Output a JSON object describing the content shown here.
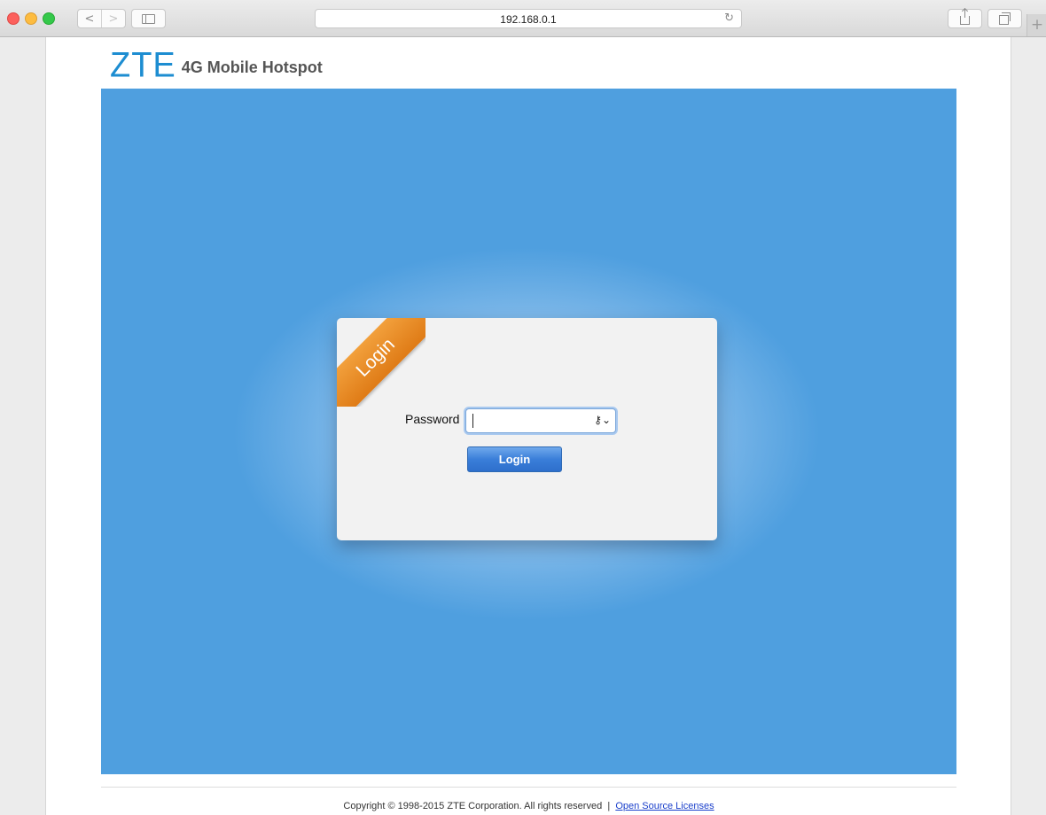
{
  "browser": {
    "url": "192.168.0.1",
    "back_symbol": "<",
    "forward_symbol": ">",
    "reload_symbol": "↻",
    "new_tab_symbol": "+"
  },
  "header": {
    "logo_brand": "ZTE",
    "logo_subtitle": "4G Mobile Hotspot"
  },
  "login": {
    "ribbon_label": "Login",
    "password_label": "Password",
    "password_value": "",
    "key_symbol": "⚷⌄",
    "button_label": "Login"
  },
  "footer": {
    "copyright": "Copyright © 1998-2015 ZTE Corporation. All rights reserved",
    "separator": "|",
    "license_link": "Open Source Licenses"
  },
  "colors": {
    "brand_blue": "#1d8dd1",
    "hero_blue": "#4f9fdf",
    "ribbon_orange": "#e98b25",
    "button_blue": "#3a7ed9",
    "link_blue": "#1a3fcb"
  },
  "icons": [
    "back-icon",
    "forward-icon",
    "sidebar-icon",
    "reload-icon",
    "share-icon",
    "tabs-icon",
    "key-icon"
  ]
}
